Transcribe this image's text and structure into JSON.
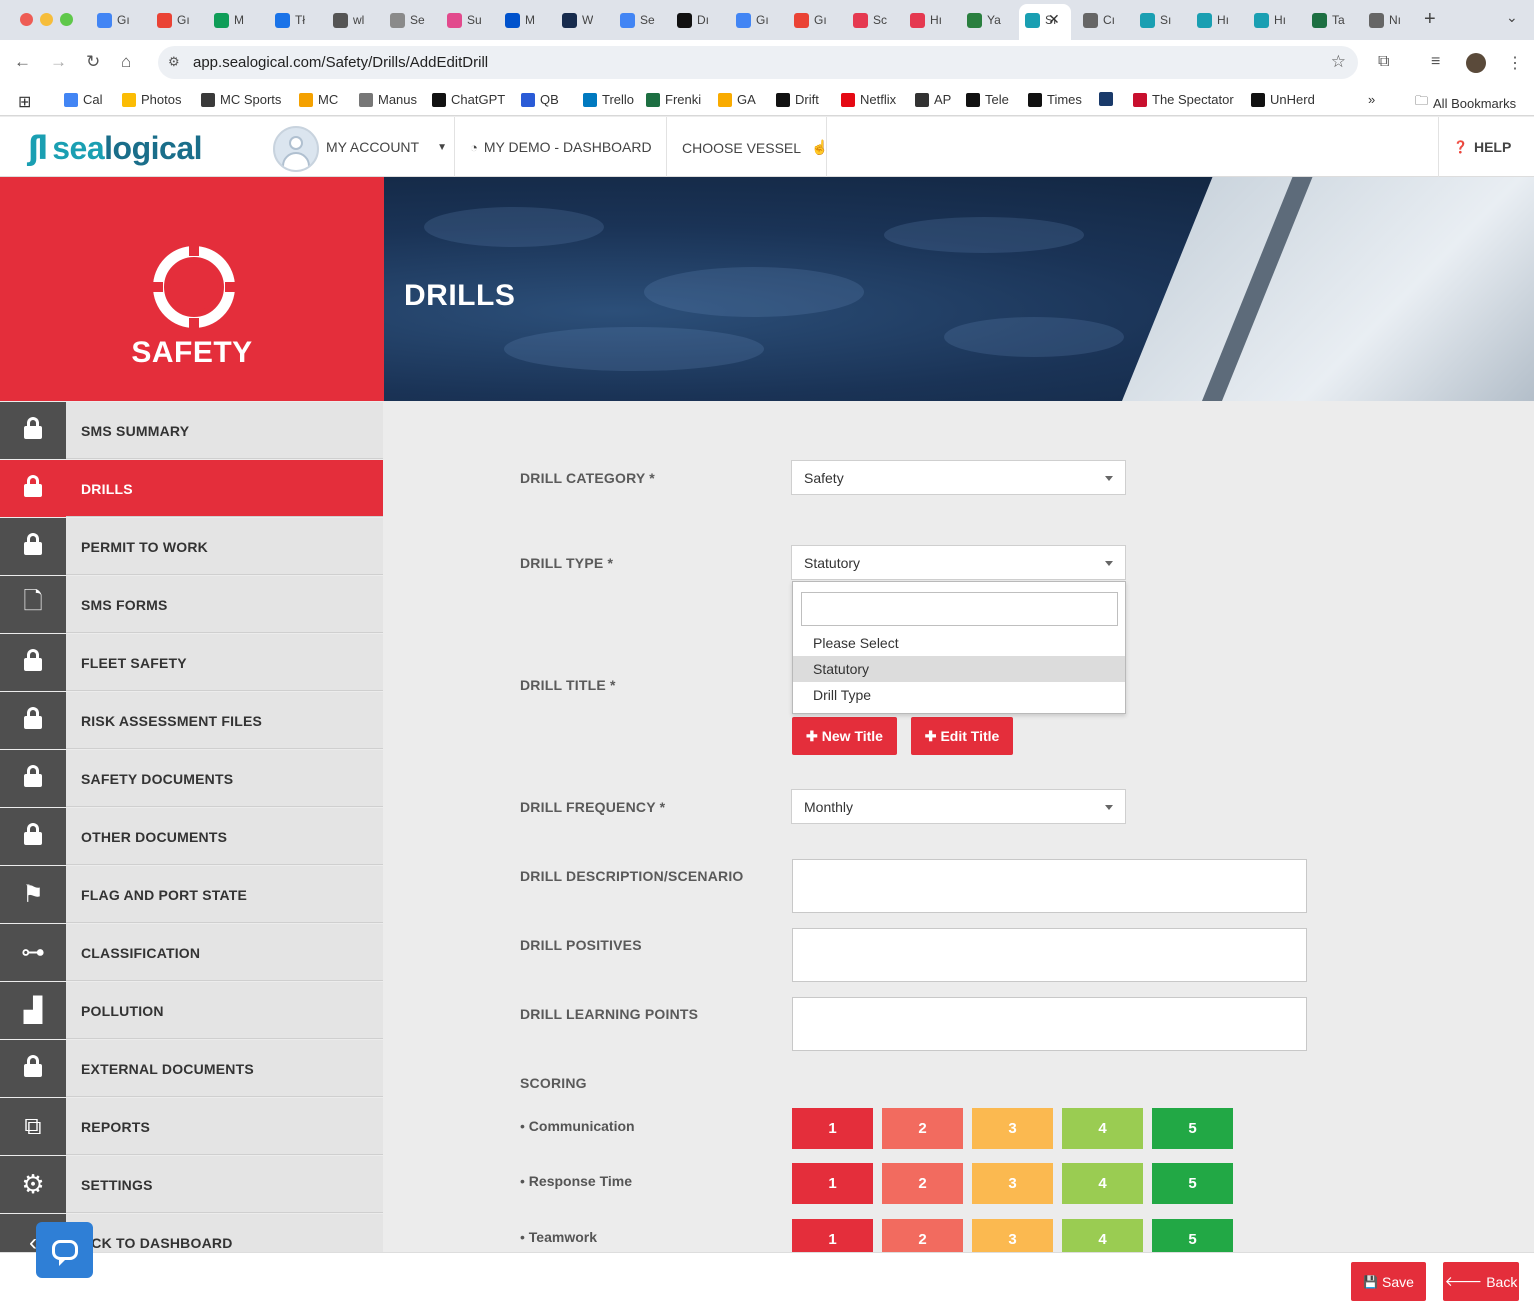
{
  "browser": {
    "tabs": [
      {
        "label": "Gı",
        "color": "#4285f4"
      },
      {
        "label": "Gı",
        "color": "#ea4335"
      },
      {
        "label": "M",
        "color": "#0f9d58"
      },
      {
        "label": "Tł",
        "color": "#1a73e8"
      },
      {
        "label": "wl",
        "color": "#555555"
      },
      {
        "label": "Se",
        "color": "#8a8a8a"
      },
      {
        "label": "Su",
        "color": "#e24a8d"
      },
      {
        "label": "M",
        "color": "#0052cc"
      },
      {
        "label": "W",
        "color": "#172b4d"
      },
      {
        "label": "Se",
        "color": "#4285f4"
      },
      {
        "label": "Dı",
        "color": "#111111"
      },
      {
        "label": "Gı",
        "color": "#4285f4"
      },
      {
        "label": "Gı",
        "color": "#ea4335"
      },
      {
        "label": "Sc",
        "color": "#e53950"
      },
      {
        "label": "Hı",
        "color": "#e53950"
      },
      {
        "label": "Ya",
        "color": "#2a7f3f"
      },
      {
        "label": "Sı",
        "color": "#1a9fb2"
      },
      {
        "label": "Cı",
        "color": "#666666"
      },
      {
        "label": "Sı",
        "color": "#1a9fb2"
      },
      {
        "label": "Hı",
        "color": "#1a9fb2"
      },
      {
        "label": "Hı",
        "color": "#1a9fb2"
      },
      {
        "label": "Ta",
        "color": "#1d6f42"
      },
      {
        "label": "Nı",
        "color": "#666666"
      }
    ],
    "url": "app.sealogical.com/Safety/Drills/AddEditDrill",
    "bookmarks": [
      {
        "label": "Cal",
        "color": "#4285f4"
      },
      {
        "label": "Photos",
        "color": "#fbbc04"
      },
      {
        "label": "MC Sports",
        "color": "#3a3a3a"
      },
      {
        "label": "MC",
        "color": "#f4a100"
      },
      {
        "label": "Manus",
        "color": "#777777"
      },
      {
        "label": "ChatGPT",
        "color": "#111111"
      },
      {
        "label": "QB",
        "color": "#2a5bd7"
      },
      {
        "label": "Trello",
        "color": "#0079bf"
      },
      {
        "label": "Frenki",
        "color": "#1d6f42"
      },
      {
        "label": "GA",
        "color": "#f9ab00"
      },
      {
        "label": "Drift",
        "color": "#111111"
      },
      {
        "label": "Netflix",
        "color": "#e50914"
      },
      {
        "label": "AP",
        "color": "#333333"
      },
      {
        "label": "Tele",
        "color": "#111111"
      },
      {
        "label": "Times",
        "color": "#111111"
      },
      {
        "label": "",
        "color": "#1a3a6a"
      },
      {
        "label": "The Spectator",
        "color": "#c8102e"
      },
      {
        "label": "UnHerd",
        "color": "#111111"
      }
    ],
    "all_bookmarks": "All Bookmarks"
  },
  "header": {
    "logo_mark": "ʃl",
    "logo_sea": "sea",
    "logo_logical": "logical",
    "my_account": "MY ACCOUNT",
    "dashboard": "MY DEMO - DASHBOARD",
    "choose_vessel": "CHOOSE VESSEL",
    "help": "HELP"
  },
  "sidebar": {
    "section_title": "SAFETY",
    "items": [
      {
        "label": "SMS SUMMARY",
        "icon": "lock-icon"
      },
      {
        "label": "DRILLS",
        "icon": "lock-icon",
        "active": true
      },
      {
        "label": "PERMIT TO WORK",
        "icon": "lock-icon"
      },
      {
        "label": "SMS FORMS",
        "icon": "document-icon"
      },
      {
        "label": "FLEET SAFETY",
        "icon": "lock-icon"
      },
      {
        "label": "RISK ASSESSMENT FILES",
        "icon": "lock-icon"
      },
      {
        "label": "SAFETY DOCUMENTS",
        "icon": "lock-icon"
      },
      {
        "label": "OTHER DOCUMENTS",
        "icon": "lock-icon"
      },
      {
        "label": "FLAG AND PORT STATE",
        "icon": "flag-icon"
      },
      {
        "label": "CLASSIFICATION",
        "icon": "hierarchy-icon"
      },
      {
        "label": "POLLUTION",
        "icon": "factory-icon"
      },
      {
        "label": "EXTERNAL DOCUMENTS",
        "icon": "lock-icon"
      },
      {
        "label": "REPORTS",
        "icon": "copy-icon"
      },
      {
        "label": "SETTINGS",
        "icon": "gears-icon"
      },
      {
        "label": "ACK TO DASHBOARD",
        "icon": "chevron-left-icon"
      }
    ]
  },
  "banner": {
    "title": "DRILLS"
  },
  "form": {
    "drill_category": {
      "label": "DRILL CATEGORY *",
      "value": "Safety"
    },
    "drill_type": {
      "label": "DRILL TYPE *",
      "value": "Statutory",
      "search_value": "",
      "options": [
        "Please Select",
        "Statutory",
        "Drill Type"
      ],
      "highlighted": "Statutory"
    },
    "drill_title": {
      "label": "DRILL TITLE *",
      "new_btn": "New Title",
      "edit_btn": "Edit Title"
    },
    "drill_frequency": {
      "label": "DRILL FREQUENCY *",
      "value": "Monthly"
    },
    "description": {
      "label": "DRILL DESCRIPTION/SCENARIO",
      "value": ""
    },
    "positives": {
      "label": "DRILL POSITIVES",
      "value": ""
    },
    "learning_points": {
      "label": "DRILL LEARNING POINTS",
      "value": ""
    },
    "scoring": {
      "label": "SCORING",
      "scale": [
        "1",
        "2",
        "3",
        "4",
        "5"
      ],
      "scale_colors": [
        "#e42e3b",
        "#f26b5f",
        "#fbb950",
        "#9acc52",
        "#22a845"
      ],
      "criteria": [
        "Communication",
        "Response Time",
        "Teamwork"
      ]
    }
  },
  "footer": {
    "save": "Save",
    "back": "Back"
  }
}
